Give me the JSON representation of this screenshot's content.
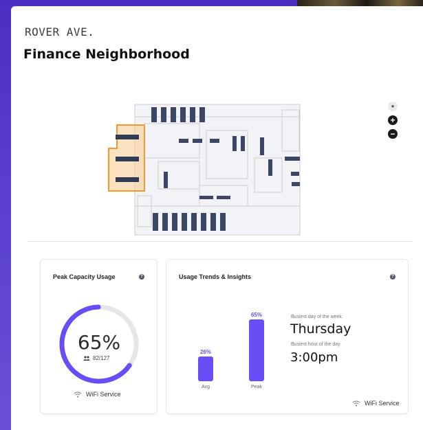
{
  "header": {
    "eyebrow": "ROVER AVE.",
    "title": "Finance Neighborhood"
  },
  "map_controls": {
    "zoom_in": "+",
    "zoom_out": "−"
  },
  "peak_capacity": {
    "title": "Peak Capacity Usage",
    "help": "?",
    "value_text": "65%",
    "value_fraction": 0.65,
    "occupancy": "82/127",
    "source": "WiFi Service"
  },
  "usage_trends": {
    "title": "Usage Trends & Insights",
    "help": "?",
    "bars": [
      {
        "label": "Avg",
        "value_text": "26%",
        "value": 26
      },
      {
        "label": "Peak",
        "value_text": "65%",
        "value": 65
      }
    ],
    "busiest_day_caption": "Busiest day of the week",
    "busiest_day": "Thursday",
    "busiest_hour_caption": "Busiest hour of the day",
    "busiest_hour": "3:00pm",
    "source": "WiFi Service"
  },
  "colors": {
    "accent": "#6a4df5",
    "highlight_zone": "#f29a2e",
    "gauge_track": "#e6e6ea"
  }
}
